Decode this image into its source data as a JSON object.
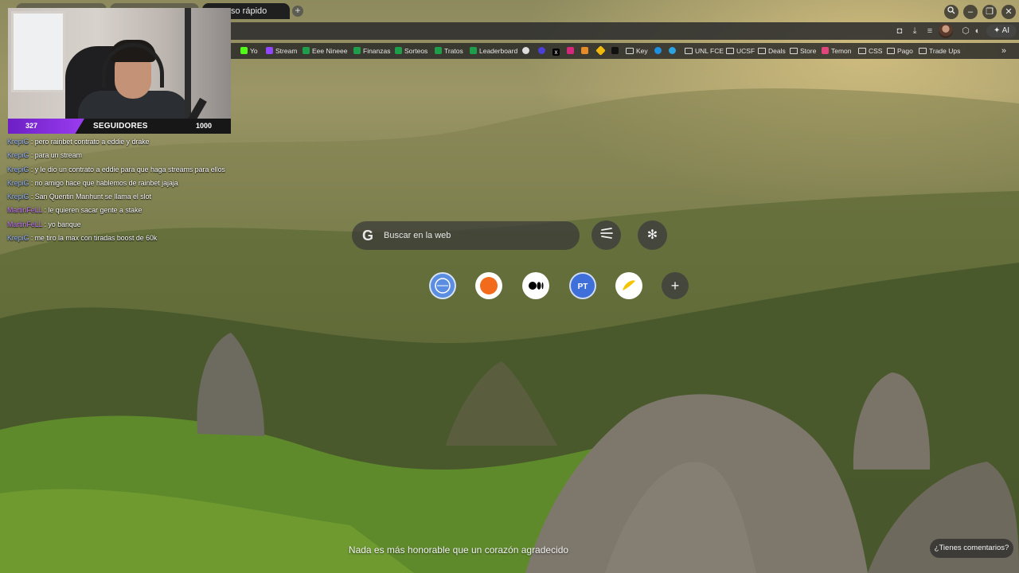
{
  "browser": {
    "active_tab_title": "so rápido",
    "new_tab_icon": "plus-icon",
    "window_controls": [
      "search-tabs-icon",
      "minimize-icon",
      "restore-icon",
      "close-icon"
    ],
    "omnibox_icons": [
      "screenshot-icon",
      "download-icon",
      "tab-list-icon",
      "avatar",
      "extension-icon",
      "theme-toggle-icon"
    ],
    "ai_button_label": "AI",
    "bookmarks": [
      {
        "label": "Yo",
        "icon": "kick-icon",
        "color": "#53fc18"
      },
      {
        "label": "Stream",
        "icon": "twitch-icon",
        "color": "#9146ff"
      },
      {
        "label": "Eee Nineee",
        "icon": "sheet-icon",
        "color": "#1e9e4a"
      },
      {
        "label": "Finanzas",
        "icon": "sheet-icon",
        "color": "#1e9e4a"
      },
      {
        "label": "Sorteos",
        "icon": "sheet-icon",
        "color": "#1e9e4a"
      },
      {
        "label": "Tratos",
        "icon": "sheet-icon",
        "color": "#1e9e4a"
      },
      {
        "label": "Leaderboard",
        "icon": "sheet-icon",
        "color": "#1e9e4a"
      },
      {
        "label": "Key",
        "icon": "folder-icon",
        "color": "#d8d8d8"
      },
      {
        "label": "UNL FCE",
        "icon": "folder-icon",
        "color": "#d8d8d8"
      },
      {
        "label": "UCSF",
        "icon": "folder-icon",
        "color": "#d8d8d8"
      },
      {
        "label": "Deals",
        "icon": "folder-icon",
        "color": "#d8d8d8"
      },
      {
        "label": "Store",
        "icon": "folder-icon",
        "color": "#d8d8d8"
      },
      {
        "label": "Temon",
        "icon": "app-icon",
        "color": "#e0457b"
      },
      {
        "label": "CSS",
        "icon": "folder-icon",
        "color": "#d8d8d8"
      },
      {
        "label": "Pago",
        "icon": "folder-icon",
        "color": "#d8d8d8"
      },
      {
        "label": "Trade Ups",
        "icon": "folder-icon",
        "color": "#d8d8d8"
      }
    ],
    "bookmark_icon_only": [
      "discord-icon",
      "app-icon",
      "x-icon",
      "instagram-icon",
      "app-icon",
      "binance-icon",
      "tiktok-icon",
      "edge-icon",
      "telegram-icon"
    ]
  },
  "overlay": {
    "followers_current": "327",
    "followers_label": "SEGUIDORES",
    "followers_goal": "1000",
    "followers_progress": 0.327,
    "chat": [
      {
        "user": "KrepiG",
        "color": "#9ab8ff",
        "message": ": pero rainbet contrato a eddie y drake"
      },
      {
        "user": "KrepiG",
        "color": "#9ab8ff",
        "message": ": para un stream"
      },
      {
        "user": "KrepiG",
        "color": "#9ab8ff",
        "message": ": y le dio un contrato a eddie para que haga streams para ellos"
      },
      {
        "user": "KrepiG",
        "color": "#9ab8ff",
        "message": ": no amigo hace que hablemos de rainbet jajaja"
      },
      {
        "user": "KrepiG",
        "color": "#9ab8ff",
        "message": ": San Quentin Manhunt se llama el slot"
      },
      {
        "user": "MartinFeLL",
        "color": "#c87bff",
        "message": ": le quieren sacar gente a stake"
      },
      {
        "user": "MartinFeLL",
        "color": "#c87bff",
        "message": ": yo banque"
      },
      {
        "user": "KrepiG",
        "color": "#9ab8ff",
        "message": ": me tiro la max con tiradas boost de 60k"
      }
    ]
  },
  "newtab": {
    "search_placeholder": "Buscar en la web",
    "search_icon": "google-icon",
    "buttons": [
      "menu-icon",
      "asterisk-icon"
    ],
    "shortcuts": [
      {
        "name": "shortcut-1",
        "color": "#5b8de0"
      },
      {
        "name": "shortcut-2",
        "color": "#f26a1b"
      },
      {
        "name": "shortcut-medium",
        "color": "#000000"
      },
      {
        "name": "shortcut-pt",
        "color": "#3f6fd8"
      },
      {
        "name": "shortcut-5",
        "color": "#f5c400"
      }
    ],
    "add_shortcut_icon": "plus-icon",
    "quote": "Nada es más honorable que un corazón agradecido",
    "feedback_label": "¿Tienes comentarios?"
  }
}
